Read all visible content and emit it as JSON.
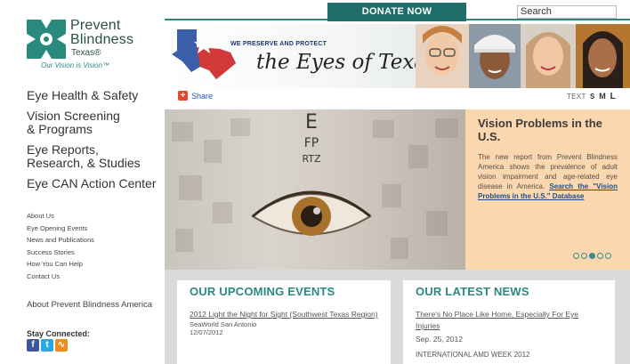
{
  "header": {
    "donate_label": "DONATE NOW",
    "search_placeholder": "Search"
  },
  "logo": {
    "line1": "Prevent",
    "line2": "Blindness",
    "line3": "Texas®",
    "tagline": "Our Vision is Vision™"
  },
  "banner": {
    "preserve_text": "WE PRESERVE AND PROTECT",
    "headline": "the Eyes of Texas"
  },
  "share_label": "Share",
  "text_size": {
    "label": "TEXT",
    "options": [
      "S",
      "M",
      "L"
    ]
  },
  "sidebar": {
    "main": [
      {
        "label": "Eye Health & Safety"
      },
      {
        "label": "Vision Screening\n& Programs"
      },
      {
        "label": "Eye Reports,\nResearch, & Studies"
      },
      {
        "label": "Eye CAN Action Center"
      }
    ],
    "sub": [
      {
        "label": "About Us"
      },
      {
        "label": "Eye Opening Events"
      },
      {
        "label": "News and Publications"
      },
      {
        "label": "Success Stories"
      },
      {
        "label": "How You Can Help"
      },
      {
        "label": "Contact Us"
      }
    ],
    "about_pba": "About Prevent Blindness America",
    "stay_connected": "Stay Connected:"
  },
  "hero": {
    "chart_rows": [
      "E",
      "FP",
      "RTZ"
    ],
    "title": "Vision Problems in the U.S.",
    "body": "The new report from Prevent Blindness America shows the prevalence of adult vision impairment and age-related eye disease in America.",
    "link_text": "Search the \"Vision Problems in the U.S.\" Database"
  },
  "events": {
    "title": "OUR UPCOMING EVENTS",
    "item_title": "2012 Light the Night for Sight (Southwest Texas Region)",
    "item_venue": "SeaWorld San Antonio",
    "item_date": "12/07/2012"
  },
  "news": {
    "title": "OUR LATEST NEWS",
    "item_title": "There's No Place Like Home, Especially For Eye Injuries",
    "item_date": "Sep. 25, 2012",
    "next_item": "INTERNATIONAL AMD WEEK 2012"
  },
  "colors": {
    "accent_teal": "#2b8a80",
    "donate_bg": "#1f6e6a",
    "caption_bg": "#fbd7b0"
  }
}
